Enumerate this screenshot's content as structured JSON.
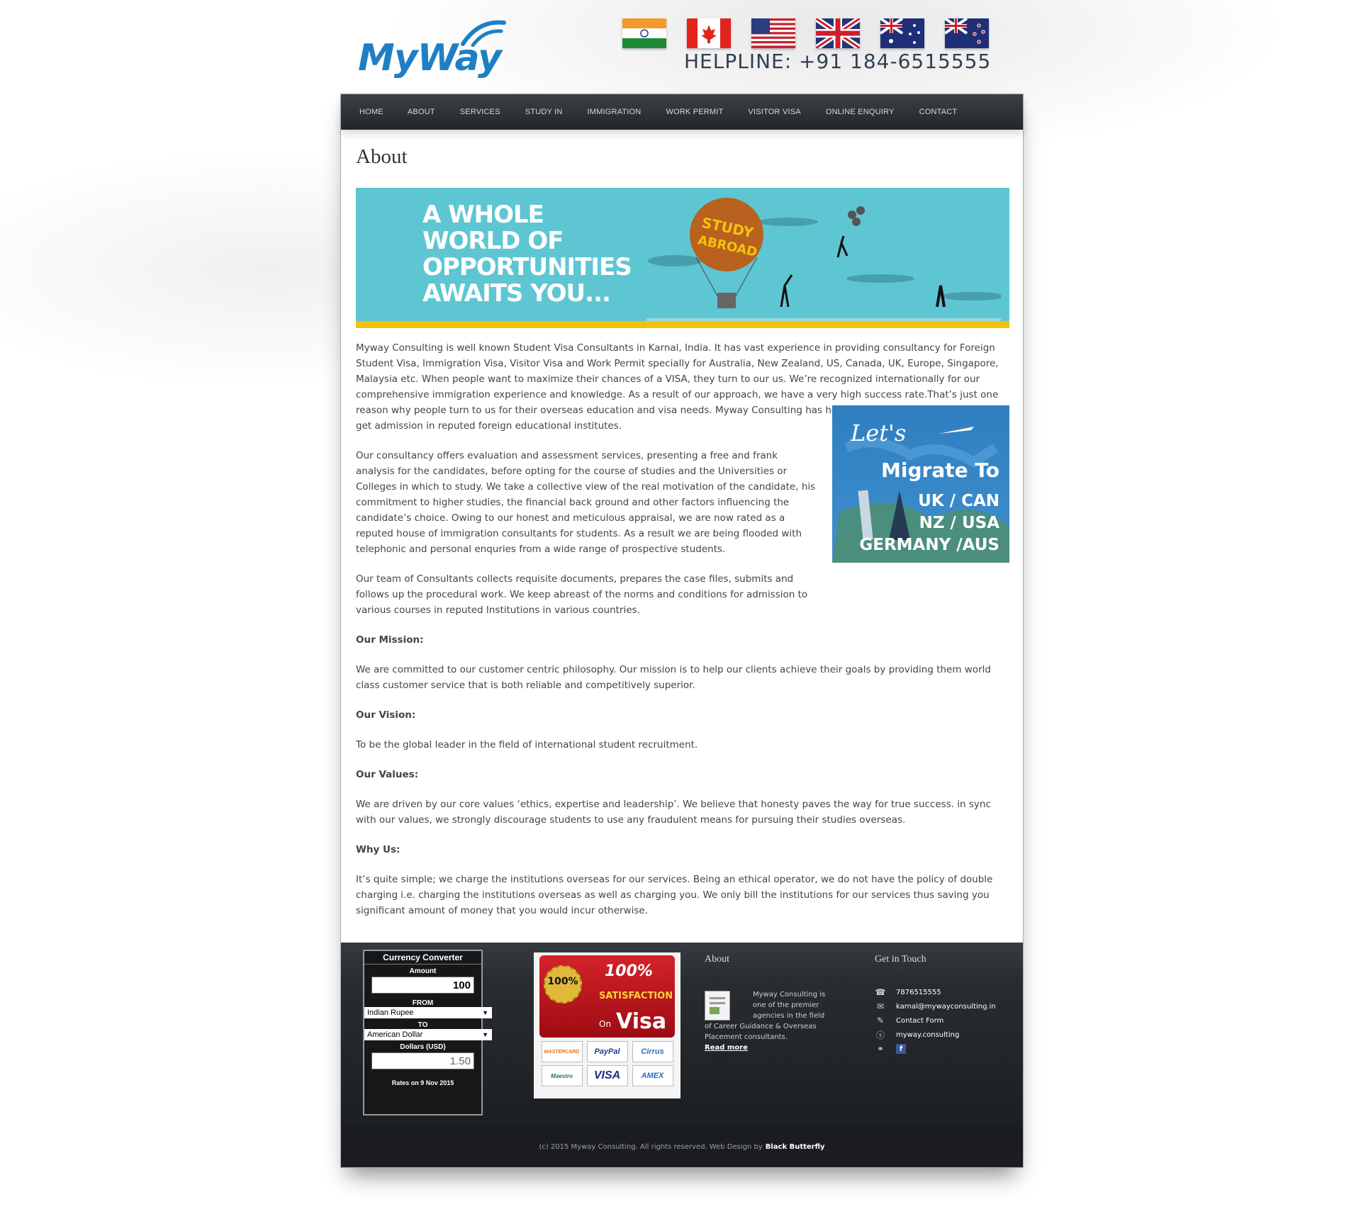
{
  "header": {
    "logo_text": "MyWay",
    "helpline": "HELPLINE: +91 184-6515555",
    "flags": [
      "india-flag",
      "canada-flag",
      "usa-flag",
      "uk-flag",
      "australia-flag",
      "new-zealand-flag"
    ]
  },
  "nav": {
    "items": [
      "HOME",
      "ABOUT",
      "SERVICES",
      "STUDY IN",
      "IMMIGRATION",
      "WORK PERMIT",
      "VISITOR VISA",
      "ONLINE ENQUIRY",
      "CONTACT"
    ]
  },
  "page": {
    "title": "About",
    "banner": {
      "line1": "A WHOLE",
      "line2": "WORLD OF",
      "line3": "OPPORTUNITIES",
      "line4": "AWAITS YOU...",
      "balloon_text_1": "STUDY",
      "balloon_text_2": "ABROAD"
    },
    "side_image": {
      "line1": "Let's",
      "line2": "Migrate To",
      "line3": "UK / CAN",
      "line4": "NZ / USA",
      "line5": "GERMANY /AUS"
    },
    "paragraphs": [
      "Myway Consulting is well known Student Visa Consultants in Karnal, India. It has vast experience in providing consultancy for Foreign Student Visa, Immigration Visa, Visitor Visa and Work Permit specially for Australia, New Zealand, US, Canada, UK, Europe, Singapore, Malaysia etc. When people want to maximize their chances of a VISA, they turn to our us. We’re recognized internationally for our comprehensive immigration experience and knowledge. As a result of our approach, we have a very high success rate.That’s just one reason why people turn to us for their overseas education and visa needs. Myway Consulting has helped a large number of students to get admission in reputed foreign educational institutes.",
      "Our consultancy offers evaluation and assessment services, presenting a free and frank analysis for the candidates, before opting for the course of studies and the Universities or Colleges in which to study. We take a collective view of the real motivation of the candidate, his commitment to higher studies, the financial back ground and other factors influencing the candidate’s choice. Owing to our honest and meticulous appraisal, we are now rated as a reputed house of immigration consultants for students. As a result we are being flooded with telephonic and personal enquries from a wide range of prospective students.",
      "Our team of Consultants collects requisite documents, prepares the case files, submits and follows up the procedural work. We keep abreast of the norms and conditions for admission to various courses in reputed Institutions in various countries."
    ],
    "mission_heading": "Our Mission:",
    "mission_text": "We are committed to our customer centric philosophy. Our mission is to help our clients achieve their goals by providing them world class customer service that is both reliable and competitively superior.",
    "vision_heading": "Our Vision:",
    "vision_text": "To be the global leader in the field of international student recruitment.",
    "values_heading": "Our Values:",
    "values_text": "We are driven by our core values ‘ethics, expertise and leadership’. We believe that honesty paves the way for true success. in sync with our values, we strongly discourage students to use any fraudulent means for pursuing their studies overseas.",
    "why_heading": "Why Us:",
    "why_text": "It’s quite simple; we charge the institutions overseas for our services. Being an ethical operator, we do not have the policy of double charging i.e. charging the institutions overseas as well as charging you. We only bill the institutions for our services thus saving you significant amount of money that you would incur otherwise."
  },
  "footer": {
    "converter": {
      "title": "Currency Converter",
      "amount_label": "Amount",
      "amount_value": "100",
      "from_label": "FROM",
      "from_value": "Indian Rupee",
      "to_label": "TO",
      "to_value": "American Dollar",
      "result_label": "Dollars (USD)",
      "result_value": "1.50",
      "rates_note": "Rates on 9 Nov 2015"
    },
    "satisfaction": {
      "seal": "100%",
      "percent": "100%",
      "word": "SATISFACTION",
      "on": "On",
      "visa": "Visa",
      "cards": [
        "MASTERCARD",
        "PayPal",
        "Cirrus",
        "Maestro",
        "VISA",
        "AMEX"
      ]
    },
    "about": {
      "title": "About",
      "text": "Myway Consulting is one of the premier agencies in the field of Career Guidance & Overseas Placement consultants.",
      "read_more": "Read more"
    },
    "contact": {
      "title": "Get in Touch",
      "phone": "7876515555",
      "email": "karnal@mywayconsulting.in",
      "form": "Contact Form",
      "skype": "myway.consulting"
    },
    "copyright": "(c) 2015 Myway Consulting. All rights reserved. Web Design by",
    "designer": "Black Butterfly"
  }
}
